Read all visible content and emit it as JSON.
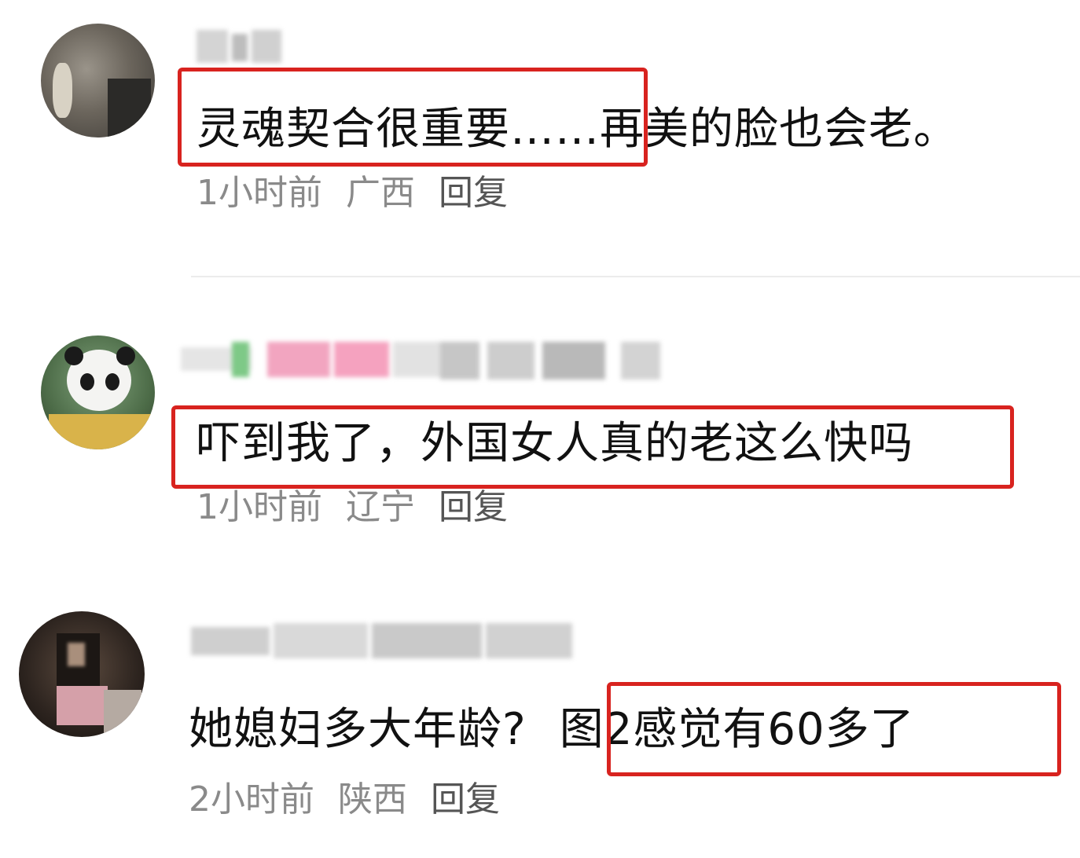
{
  "comments": [
    {
      "text_part1": "灵魂契合很重要……",
      "text_part2": "再美的脸也会老。",
      "time": "1小时前",
      "location": "广西",
      "reply_label": "回复"
    },
    {
      "text": "吓到我了，外国女人真的老这么快吗",
      "time": "1小时前",
      "location": "辽宁",
      "reply_label": "回复"
    },
    {
      "text_part1": "她媳妇多大年龄?",
      "text_part2": "图2感觉有60多了",
      "time": "2小时前",
      "location": "陕西",
      "reply_label": "回复"
    }
  ],
  "colors": {
    "highlight": "#d8231f",
    "meta_text": "#8a8a8a",
    "body_text": "#111111"
  },
  "icons": [
    "user-avatar-photo",
    "panda-avatar-photo",
    "user-avatar-night-photo"
  ]
}
